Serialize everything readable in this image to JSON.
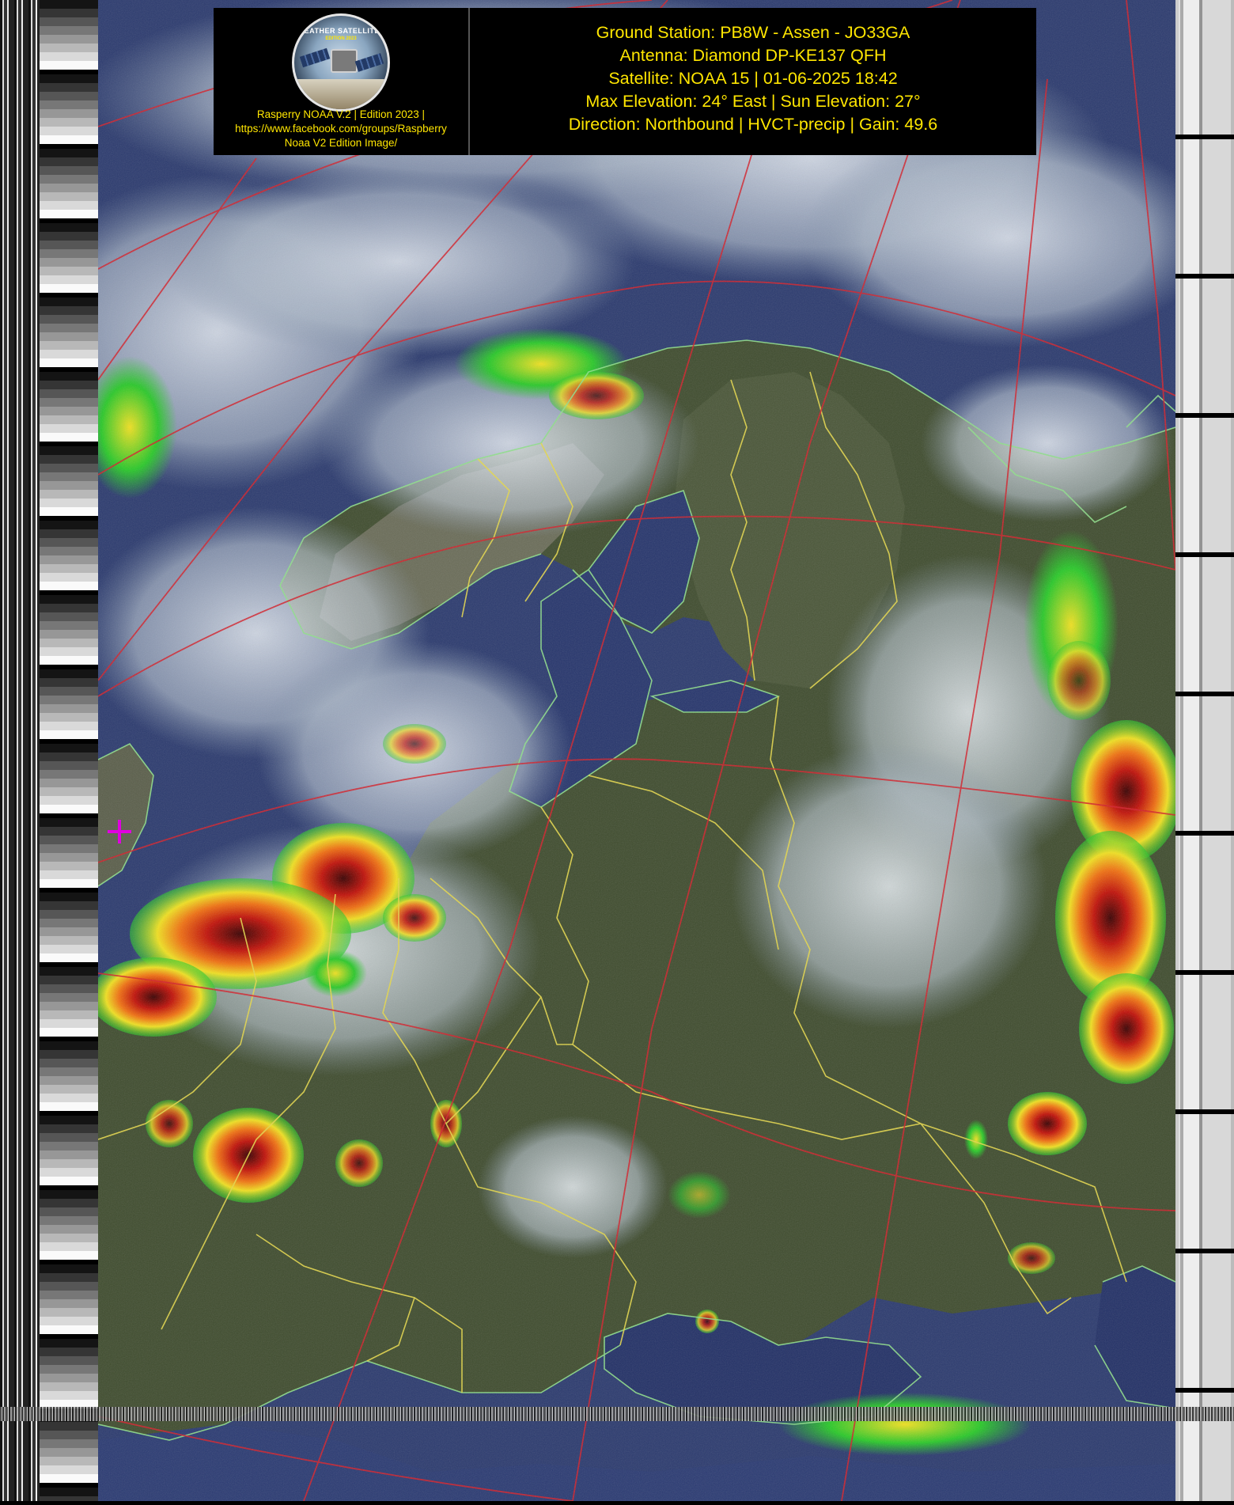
{
  "header": {
    "logo": {
      "badge_title": "WEATHER SATELLITES",
      "badge_edition": "EDITION 2023",
      "caption_lines": [
        "Rasperry NOAA V.2 | Edition 2023 |",
        "https://www.facebook.com/groups/Raspberry",
        "Noaa V2 Edition Image/"
      ]
    },
    "info_lines": [
      "Ground Station: PB8W - Assen - JO33GA",
      "Antenna: Diamond DP-KE137 QFH",
      "Satellite: NOAA 15 | 01-06-2025 18:42",
      "Max Elevation: 24° East | Sun Elevation: 27°",
      "Direction: Northbound | HVCT-precip | Gain: 49.6"
    ]
  },
  "colors": {
    "text_accent": "#ffe600",
    "graticule": "#d4202a",
    "country_border": "#e6d84a",
    "coastline": "#8fe08a",
    "marker": "#e000e0",
    "ocean": "#2b3a6e",
    "land": "#3c4a2c",
    "cloud": "#c8d2dc",
    "precip_light": "#28c828",
    "precip_mid": "#f0e020",
    "precip_heavy": "#e02010",
    "precip_extreme": "#3a0000"
  },
  "icons": {
    "logo": "weather-satellite-badge-icon",
    "marker": "plus-marker-icon"
  }
}
